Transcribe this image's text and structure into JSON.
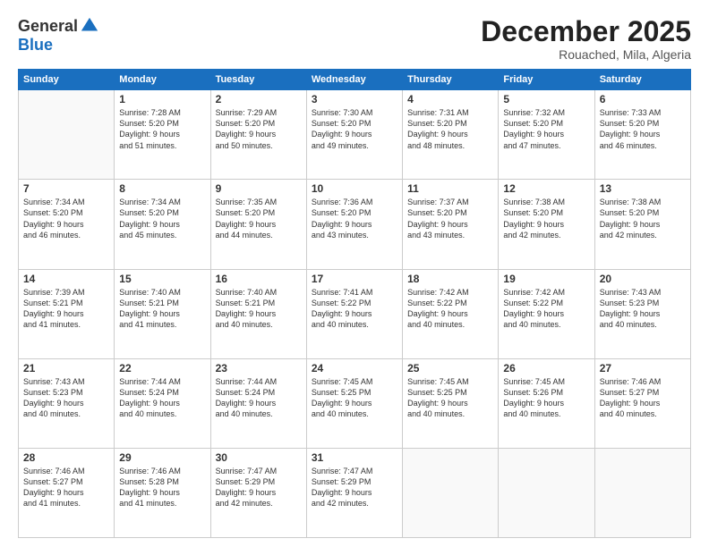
{
  "logo": {
    "general": "General",
    "blue": "Blue"
  },
  "title": "December 2025",
  "subtitle": "Rouached, Mila, Algeria",
  "days_header": [
    "Sunday",
    "Monday",
    "Tuesday",
    "Wednesday",
    "Thursday",
    "Friday",
    "Saturday"
  ],
  "weeks": [
    [
      {
        "num": "",
        "info": ""
      },
      {
        "num": "1",
        "info": "Sunrise: 7:28 AM\nSunset: 5:20 PM\nDaylight: 9 hours\nand 51 minutes."
      },
      {
        "num": "2",
        "info": "Sunrise: 7:29 AM\nSunset: 5:20 PM\nDaylight: 9 hours\nand 50 minutes."
      },
      {
        "num": "3",
        "info": "Sunrise: 7:30 AM\nSunset: 5:20 PM\nDaylight: 9 hours\nand 49 minutes."
      },
      {
        "num": "4",
        "info": "Sunrise: 7:31 AM\nSunset: 5:20 PM\nDaylight: 9 hours\nand 48 minutes."
      },
      {
        "num": "5",
        "info": "Sunrise: 7:32 AM\nSunset: 5:20 PM\nDaylight: 9 hours\nand 47 minutes."
      },
      {
        "num": "6",
        "info": "Sunrise: 7:33 AM\nSunset: 5:20 PM\nDaylight: 9 hours\nand 46 minutes."
      }
    ],
    [
      {
        "num": "7",
        "info": "Sunrise: 7:34 AM\nSunset: 5:20 PM\nDaylight: 9 hours\nand 46 minutes."
      },
      {
        "num": "8",
        "info": "Sunrise: 7:34 AM\nSunset: 5:20 PM\nDaylight: 9 hours\nand 45 minutes."
      },
      {
        "num": "9",
        "info": "Sunrise: 7:35 AM\nSunset: 5:20 PM\nDaylight: 9 hours\nand 44 minutes."
      },
      {
        "num": "10",
        "info": "Sunrise: 7:36 AM\nSunset: 5:20 PM\nDaylight: 9 hours\nand 43 minutes."
      },
      {
        "num": "11",
        "info": "Sunrise: 7:37 AM\nSunset: 5:20 PM\nDaylight: 9 hours\nand 43 minutes."
      },
      {
        "num": "12",
        "info": "Sunrise: 7:38 AM\nSunset: 5:20 PM\nDaylight: 9 hours\nand 42 minutes."
      },
      {
        "num": "13",
        "info": "Sunrise: 7:38 AM\nSunset: 5:20 PM\nDaylight: 9 hours\nand 42 minutes."
      }
    ],
    [
      {
        "num": "14",
        "info": "Sunrise: 7:39 AM\nSunset: 5:21 PM\nDaylight: 9 hours\nand 41 minutes."
      },
      {
        "num": "15",
        "info": "Sunrise: 7:40 AM\nSunset: 5:21 PM\nDaylight: 9 hours\nand 41 minutes."
      },
      {
        "num": "16",
        "info": "Sunrise: 7:40 AM\nSunset: 5:21 PM\nDaylight: 9 hours\nand 40 minutes."
      },
      {
        "num": "17",
        "info": "Sunrise: 7:41 AM\nSunset: 5:22 PM\nDaylight: 9 hours\nand 40 minutes."
      },
      {
        "num": "18",
        "info": "Sunrise: 7:42 AM\nSunset: 5:22 PM\nDaylight: 9 hours\nand 40 minutes."
      },
      {
        "num": "19",
        "info": "Sunrise: 7:42 AM\nSunset: 5:22 PM\nDaylight: 9 hours\nand 40 minutes."
      },
      {
        "num": "20",
        "info": "Sunrise: 7:43 AM\nSunset: 5:23 PM\nDaylight: 9 hours\nand 40 minutes."
      }
    ],
    [
      {
        "num": "21",
        "info": "Sunrise: 7:43 AM\nSunset: 5:23 PM\nDaylight: 9 hours\nand 40 minutes."
      },
      {
        "num": "22",
        "info": "Sunrise: 7:44 AM\nSunset: 5:24 PM\nDaylight: 9 hours\nand 40 minutes."
      },
      {
        "num": "23",
        "info": "Sunrise: 7:44 AM\nSunset: 5:24 PM\nDaylight: 9 hours\nand 40 minutes."
      },
      {
        "num": "24",
        "info": "Sunrise: 7:45 AM\nSunset: 5:25 PM\nDaylight: 9 hours\nand 40 minutes."
      },
      {
        "num": "25",
        "info": "Sunrise: 7:45 AM\nSunset: 5:25 PM\nDaylight: 9 hours\nand 40 minutes."
      },
      {
        "num": "26",
        "info": "Sunrise: 7:45 AM\nSunset: 5:26 PM\nDaylight: 9 hours\nand 40 minutes."
      },
      {
        "num": "27",
        "info": "Sunrise: 7:46 AM\nSunset: 5:27 PM\nDaylight: 9 hours\nand 40 minutes."
      }
    ],
    [
      {
        "num": "28",
        "info": "Sunrise: 7:46 AM\nSunset: 5:27 PM\nDaylight: 9 hours\nand 41 minutes."
      },
      {
        "num": "29",
        "info": "Sunrise: 7:46 AM\nSunset: 5:28 PM\nDaylight: 9 hours\nand 41 minutes."
      },
      {
        "num": "30",
        "info": "Sunrise: 7:47 AM\nSunset: 5:29 PM\nDaylight: 9 hours\nand 42 minutes."
      },
      {
        "num": "31",
        "info": "Sunrise: 7:47 AM\nSunset: 5:29 PM\nDaylight: 9 hours\nand 42 minutes."
      },
      {
        "num": "",
        "info": ""
      },
      {
        "num": "",
        "info": ""
      },
      {
        "num": "",
        "info": ""
      }
    ]
  ]
}
